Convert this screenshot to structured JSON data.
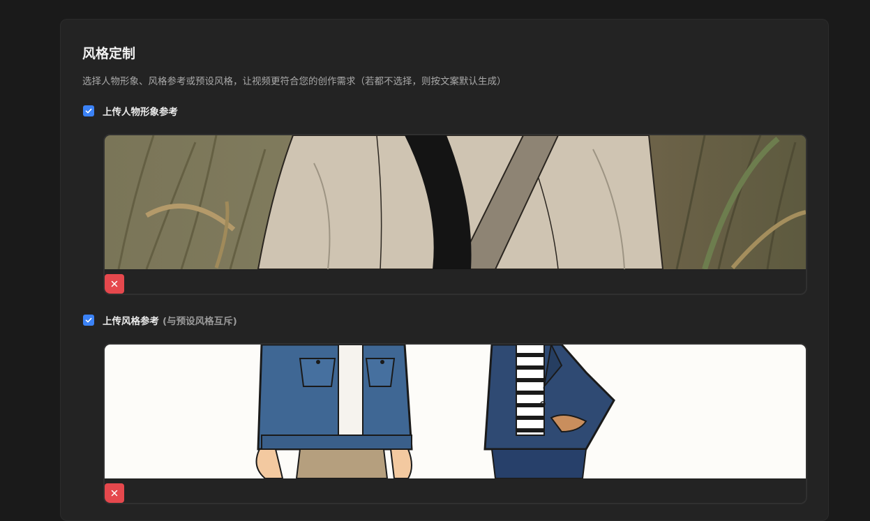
{
  "section": {
    "title": "风格定制",
    "description": "选择人物形象、风格参考或预设风格，让视频更符合您的创作需求（若都不选择，则按文案默认生成）"
  },
  "character_ref": {
    "label": "上传人物形象参考",
    "checked": true
  },
  "style_ref": {
    "label": "上传风格参考",
    "hint": "(与预设风格互斥)",
    "checked": true
  },
  "colors": {
    "accent": "#3b82f6",
    "danger": "#e5484d",
    "panel": "#232323"
  }
}
